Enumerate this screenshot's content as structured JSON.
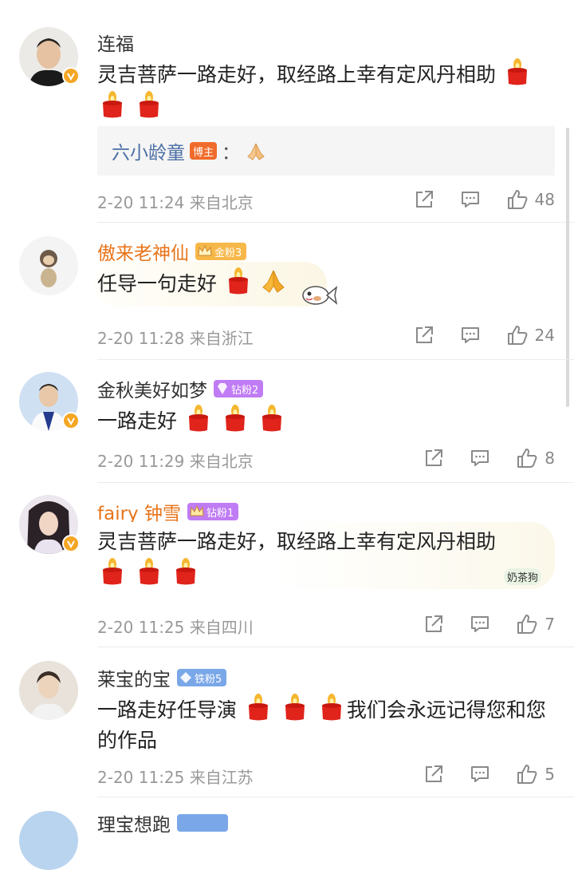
{
  "comments": [
    {
      "username": "连福",
      "verified": true,
      "text": "灵吉菩萨一路走好，取经路上幸有定风丹相助",
      "reply": {
        "name": "六小龄童",
        "badge": "博主",
        "sep": "："
      },
      "time": "2-20 11:24",
      "location": "来自北京",
      "likes": "48"
    },
    {
      "username": "傲来老神仙",
      "badge": "金粉3",
      "text": "任导一句走好",
      "time": "2-20 11:28",
      "location": "来自浙江",
      "likes": "24"
    },
    {
      "username": "金秋美好如梦",
      "verified": true,
      "badge": "钻粉2",
      "text": "一路走好",
      "time": "2-20 11:29",
      "location": "来自北京",
      "likes": "8"
    },
    {
      "username": "fairy 钟雪",
      "verified": true,
      "badge": "钻粉1",
      "text": "灵吉菩萨一路走好，取经路上幸有定风丹相助",
      "watermark": "奶茶狗",
      "time": "2-20 11:25",
      "location": "来自四川",
      "likes": "7"
    },
    {
      "username": "莱宝的宝",
      "badge": "铁粉5",
      "text_a": "一路走好任导演",
      "text_b": "我们会永远记得您和您的作品",
      "time": "2-20 11:25",
      "location": "来自江苏",
      "likes": "5"
    },
    {
      "username": "理宝想跑"
    }
  ],
  "colors": {
    "accent_name": "#e8741a",
    "reply_name": "#4a6fa5",
    "meta": "#999999"
  }
}
